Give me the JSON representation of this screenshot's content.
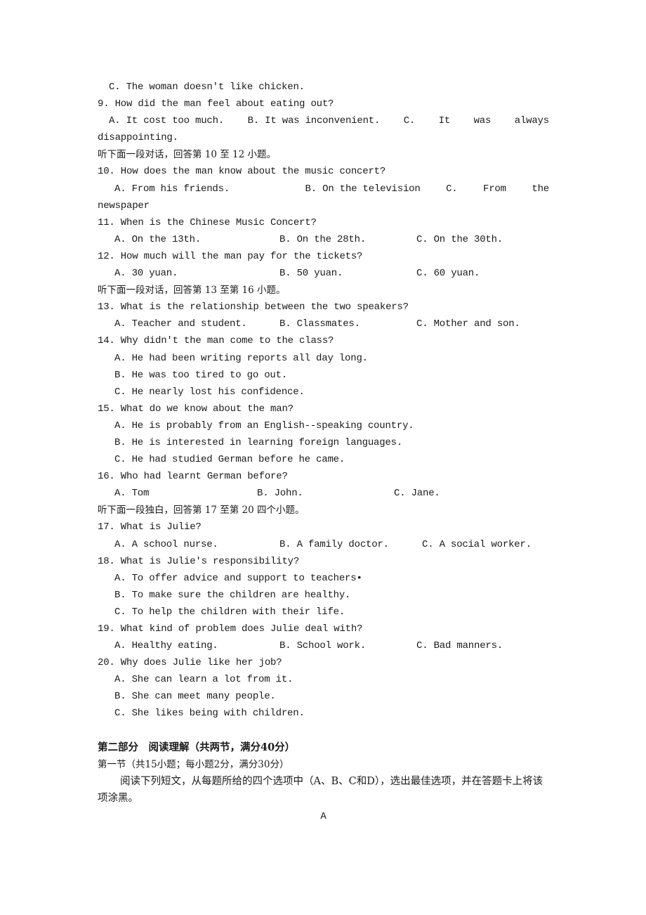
{
  "listening": {
    "q8_option_c": "C. The woman doesn't like chicken.",
    "questions": {
      "q9": {
        "stem": "9. How did the man feel about eating out?",
        "a": "A. It cost too much.",
        "b": "B. It was inconvenient.",
        "c_words": [
          "C.",
          "It",
          "was",
          "always"
        ],
        "c_cont": "disappointing."
      },
      "instr_10_12": "听下面一段对话，回答第 10 至 12 小题。",
      "q10": {
        "stem": "10. How does the man know about the music concert?",
        "a": "A. From his friends.",
        "b": "B. On the television",
        "c_words": [
          "C.",
          "From",
          "the"
        ],
        "c_cont": "newspaper"
      },
      "q11": {
        "stem": "11. When is the Chinese Music Concert?",
        "a": "A. On the 13th.",
        "b": "B. On the 28th.",
        "c": "C. On the 30th."
      },
      "q12": {
        "stem": "12. How much will the man pay for the tickets?",
        "a": "A. 30 yuan.",
        "b": "B. 50 yuan.",
        "c": "C. 60 yuan."
      },
      "instr_13_16": "听下面一段对话，回答第 13 至第 16 小题。",
      "q13": {
        "stem": "13. What is the relationship between the two speakers?",
        "a": "A. Teacher and student.",
        "b": "B. Classmates.",
        "c": "C. Mother and son."
      },
      "q14": {
        "stem": "14. Why didn't the man come to the class?",
        "a": "A. He had been writing reports all day long.",
        "b": "B. He was too tired to go out.",
        "c": "C. He nearly lost his confidence."
      },
      "q15": {
        "stem": "15. What do we know about the man?",
        "a": "A. He is probably from an English--speaking country.",
        "b": "B. He is interested in learning foreign languages.",
        "c": "C. He had studied German before he came."
      },
      "q16": {
        "stem": "16. Who had learnt German before?",
        "a": "A. Tom",
        "b": "B. John.",
        "c": "C. Jane."
      },
      "instr_17_20": "听下面一段独白，回答第 17 至第 20 四个小题。",
      "q17": {
        "stem": "17. What is Julie?",
        "a": "A. A school nurse.",
        "b": "B. A family doctor.",
        "c": "C. A social worker."
      },
      "q18": {
        "stem": "18. What is Julie's responsibility?",
        "a": "A. To offer advice and support to teachers•",
        "b": "B. To make sure the children are healthy.",
        "c": "C. To help the children with their life."
      },
      "q19": {
        "stem": "19. What kind of problem does Julie deal with?",
        "a": "A. Healthy eating.",
        "b": "B. School work.",
        "c": "C. Bad manners."
      },
      "q20": {
        "stem": "20. Why does Julie like her job?",
        "a": "A. She can learn a lot from it.",
        "b": "B. She can meet many people.",
        "c": "C. She likes being with children."
      }
    }
  },
  "reading": {
    "part_title": "第二部分　阅读理解（共两节，满分40分）",
    "section_title": "第一节（共15小题；每小题2分，满分30分）",
    "instructions": "阅读下列短文，从每题所给的四个选项中（A、B、C和D），选出最佳选项，并在答题卡上将该项涂黑。",
    "passage_label": "A"
  }
}
